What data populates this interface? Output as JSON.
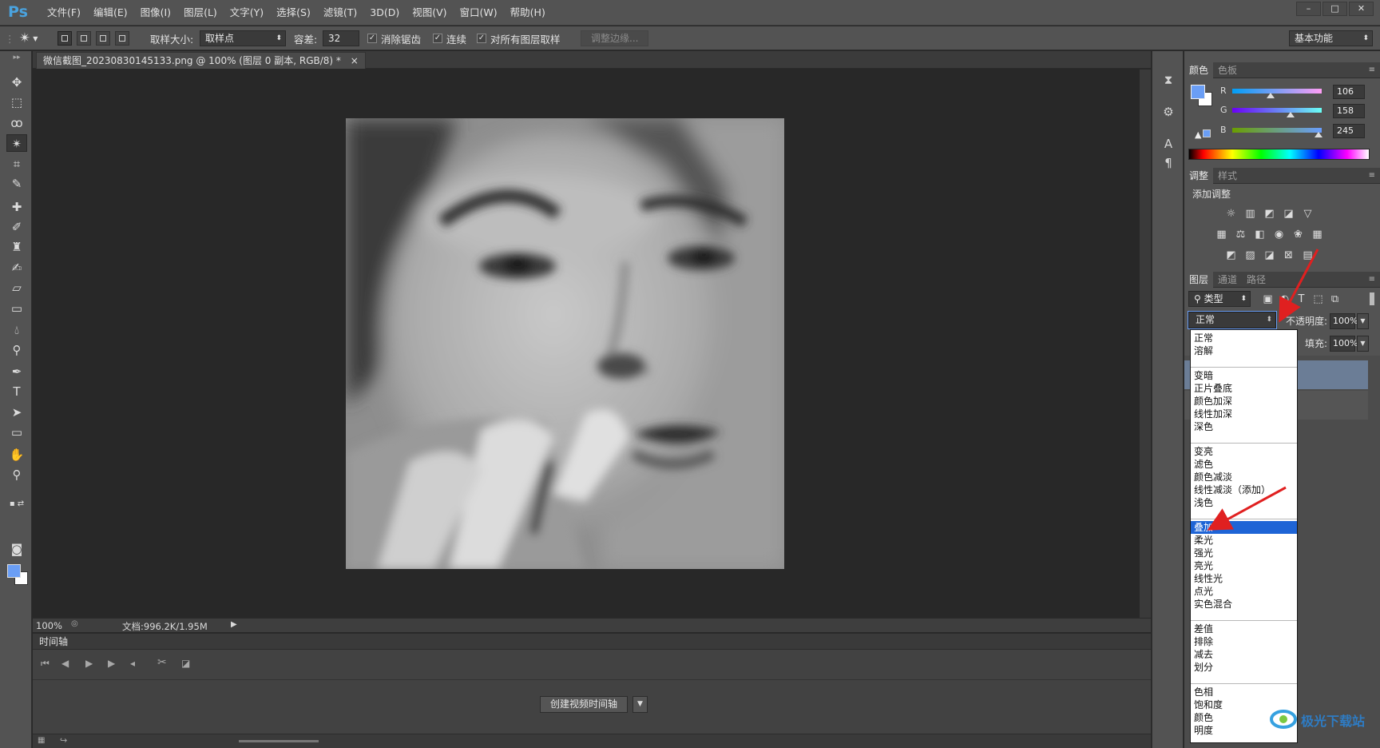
{
  "app": {
    "logo": "Ps",
    "menu": [
      "文件(F)",
      "编辑(E)",
      "图像(I)",
      "图层(L)",
      "文字(Y)",
      "选择(S)",
      "滤镜(T)",
      "3D(D)",
      "视图(V)",
      "窗口(W)",
      "帮助(H)"
    ],
    "window_controls": [
      "–",
      "□",
      "✕"
    ]
  },
  "options": {
    "sample_size_label": "取样大小:",
    "sample_size_value": "取样点",
    "tolerance_label": "容差:",
    "tolerance_value": "32",
    "antialias_label": "消除锯齿",
    "contiguous_label": "连续",
    "all_layers_label": "对所有图层取样",
    "refine_edge_label": "调整边缘...",
    "workspace_value": "基本功能"
  },
  "document": {
    "tab_title": "微信截图_20230830145133.png @ 100% (图层 0 副本, RGB/8) *",
    "tab_close": "×",
    "zoom": "100%",
    "doc_info": "文档:996.2K/1.95M"
  },
  "timeline": {
    "title": "时间轴",
    "create_button": "创建视频时间轴"
  },
  "color_panel": {
    "tabs": [
      "颜色",
      "色板"
    ],
    "channels": [
      {
        "label": "R",
        "value": "106"
      },
      {
        "label": "G",
        "value": "158"
      },
      {
        "label": "B",
        "value": "245"
      }
    ],
    "foreground_color": "#6a9ef5"
  },
  "adjust_panel": {
    "tabs": [
      "调整",
      "样式"
    ],
    "add_label": "添加调整"
  },
  "layers_panel": {
    "tabs": [
      "图层",
      "通道",
      "路径"
    ],
    "filter_label": "类型",
    "blend_mode": "正常",
    "opacity_label": "不透明度:",
    "opacity_value": "100%",
    "fill_label": "填充:",
    "fill_value": "100%"
  },
  "blend_modes": [
    [
      "正常",
      "溶解"
    ],
    [
      "变暗",
      "正片叠底",
      "颜色加深",
      "线性加深",
      "深色"
    ],
    [
      "变亮",
      "滤色",
      "颜色减淡",
      "线性减淡（添加）",
      "浅色"
    ],
    [
      "叠加",
      "柔光",
      "强光",
      "亮光",
      "线性光",
      "点光",
      "实色混合"
    ],
    [
      "差值",
      "排除",
      "减去",
      "划分"
    ],
    [
      "色相",
      "饱和度",
      "颜色",
      "明度"
    ]
  ],
  "selected_blend_mode": "叠加",
  "watermark": {
    "text": "极光下载站"
  }
}
